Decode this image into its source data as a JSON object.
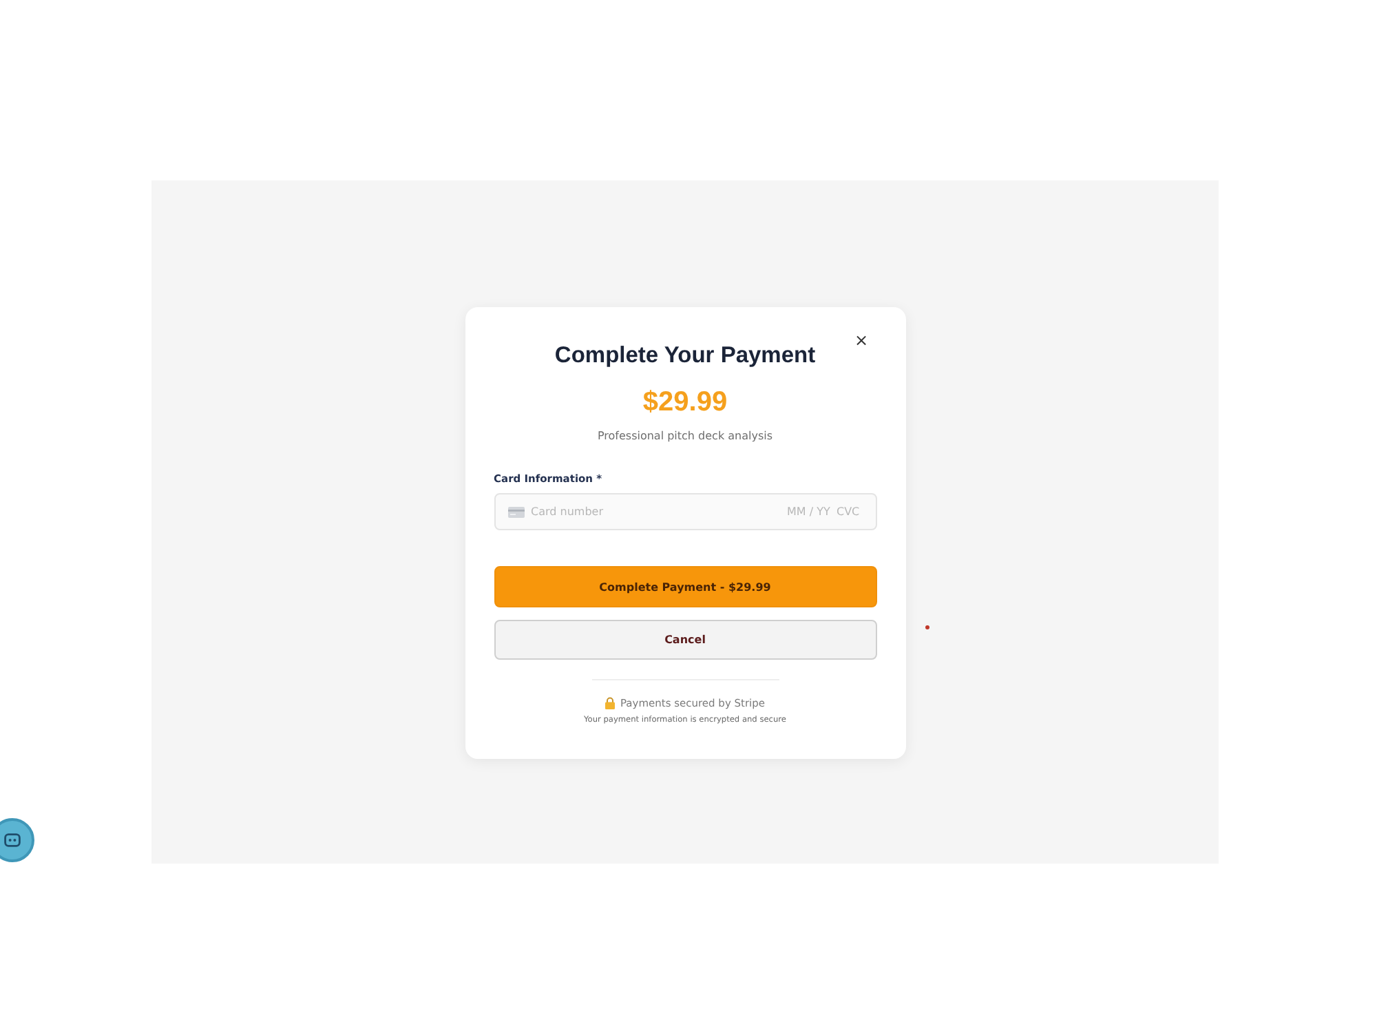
{
  "modal": {
    "title": "Complete Your Payment",
    "close_label": "×",
    "price": "$29.99",
    "description": "Professional pitch deck analysis"
  },
  "card_field": {
    "label": "Card Information *",
    "card_number_placeholder": "Card number",
    "expiry_placeholder": "MM / YY",
    "cvc_placeholder": "CVC"
  },
  "buttons": [
    {
      "kind": "primary",
      "label": "Complete Payment - $29.99"
    },
    {
      "kind": "secondary",
      "label": "Cancel"
    }
  ],
  "security": {
    "title": "Payments secured by Stripe",
    "note": "Your payment information is encrypted and secure"
  }
}
